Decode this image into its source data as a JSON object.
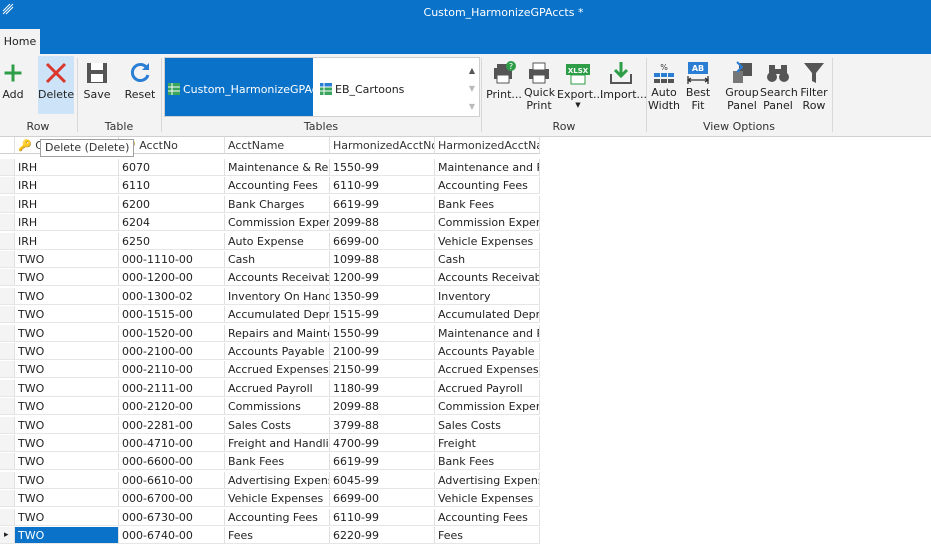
{
  "window": {
    "title": "Custom_HarmonizeGPAccts *"
  },
  "tabs": [
    {
      "label": "Home"
    }
  ],
  "ribbon": {
    "row_group": {
      "label": "Row",
      "add": "Add",
      "delete": "Delete"
    },
    "table_group": {
      "label": "Table",
      "save": "Save",
      "reset": "Reset"
    },
    "tables_group": {
      "label": "Tables",
      "items": [
        "Custom_HarmonizeGPAccts",
        "EB_Cartoons"
      ]
    },
    "row2_group": {
      "label": "Row",
      "print": "Print...",
      "quick_print_1": "Quick",
      "quick_print_2": "Print",
      "export": "Export...",
      "import": "Import..."
    },
    "view_group": {
      "label": "View Options",
      "auto_width_1": "Auto",
      "auto_width_2": "Width",
      "best_fit_1": "Best",
      "best_fit_2": "Fit",
      "group_panel_1": "Group",
      "group_panel_2": "Panel",
      "search_panel_1": "Search",
      "search_panel_2": "Panel",
      "filter_row_1": "Filter",
      "filter_row_2": "Row"
    }
  },
  "tooltip": "Delete (Delete)",
  "columns": [
    "C",
    "AcctNo",
    "AcctName",
    "HarmonizedAcctNo",
    "HarmonizedAcctNa..."
  ],
  "rows": [
    [
      "IRH",
      "6070",
      "Maintenance & Re...",
      "1550-99",
      "Maintenance and R..."
    ],
    [
      "IRH",
      "6110",
      "Accounting Fees",
      "6110-99",
      "Accounting Fees"
    ],
    [
      "IRH",
      "6200",
      "Bank Charges",
      "6619-99",
      "Bank Fees"
    ],
    [
      "IRH",
      "6204",
      "Commission Expen...",
      "2099-88",
      "Commission Expense"
    ],
    [
      "IRH",
      "6250",
      "Auto Expense",
      "6699-00",
      "Vehicle Expenses"
    ],
    [
      "TWO",
      "000-1110-00",
      "Cash",
      "1099-88",
      "Cash"
    ],
    [
      "TWO",
      "000-1200-00",
      "Accounts Receivable",
      "1200-99",
      "Accounts Receivable"
    ],
    [
      "TWO",
      "000-1300-02",
      "Inventory On Hand",
      "1350-99",
      "Inventory"
    ],
    [
      "TWO",
      "000-1515-00",
      "Accumulated Depr...",
      "1515-99",
      "Accumulated Depr..."
    ],
    [
      "TWO",
      "000-1520-00",
      "Repairs and Mainte...",
      "1550-99",
      "Maintenance and R..."
    ],
    [
      "TWO",
      "000-2100-00",
      "Accounts Payable",
      "2100-99",
      "Accounts Payable"
    ],
    [
      "TWO",
      "000-2110-00",
      "Accrued Expenses",
      "2150-99",
      "Accrued Expenses"
    ],
    [
      "TWO",
      "000-2111-00",
      "Accrued Payroll",
      "1180-99",
      "Accrued Payroll"
    ],
    [
      "TWO",
      "000-2120-00",
      "Commissions",
      "2099-88",
      "Commission Expense"
    ],
    [
      "TWO",
      "000-2281-00",
      "Sales Costs",
      "3799-88",
      "Sales Costs"
    ],
    [
      "TWO",
      "000-4710-00",
      "Freight and Handli...",
      "4700-99",
      "Freight"
    ],
    [
      "TWO",
      "000-6600-00",
      "Bank Fees",
      "6619-99",
      "Bank Fees"
    ],
    [
      "TWO",
      "000-6610-00",
      "Advertising Expense",
      "6045-99",
      "Advertising Expense"
    ],
    [
      "TWO",
      "000-6700-00",
      "Vehicle Expenses",
      "6699-00",
      "Vehicle Expenses"
    ],
    [
      "TWO",
      "000-6730-00",
      "Accounting Fees",
      "6110-99",
      "Accounting Fees"
    ],
    [
      "TWO",
      "000-6740-00",
      "Fees",
      "6220-99",
      "Fees"
    ]
  ],
  "colors": {
    "accent": "#0a72c9",
    "ribbon_bg": "#f3f3f3",
    "add_green": "#2e9d48",
    "delete_red": "#d9362c"
  }
}
